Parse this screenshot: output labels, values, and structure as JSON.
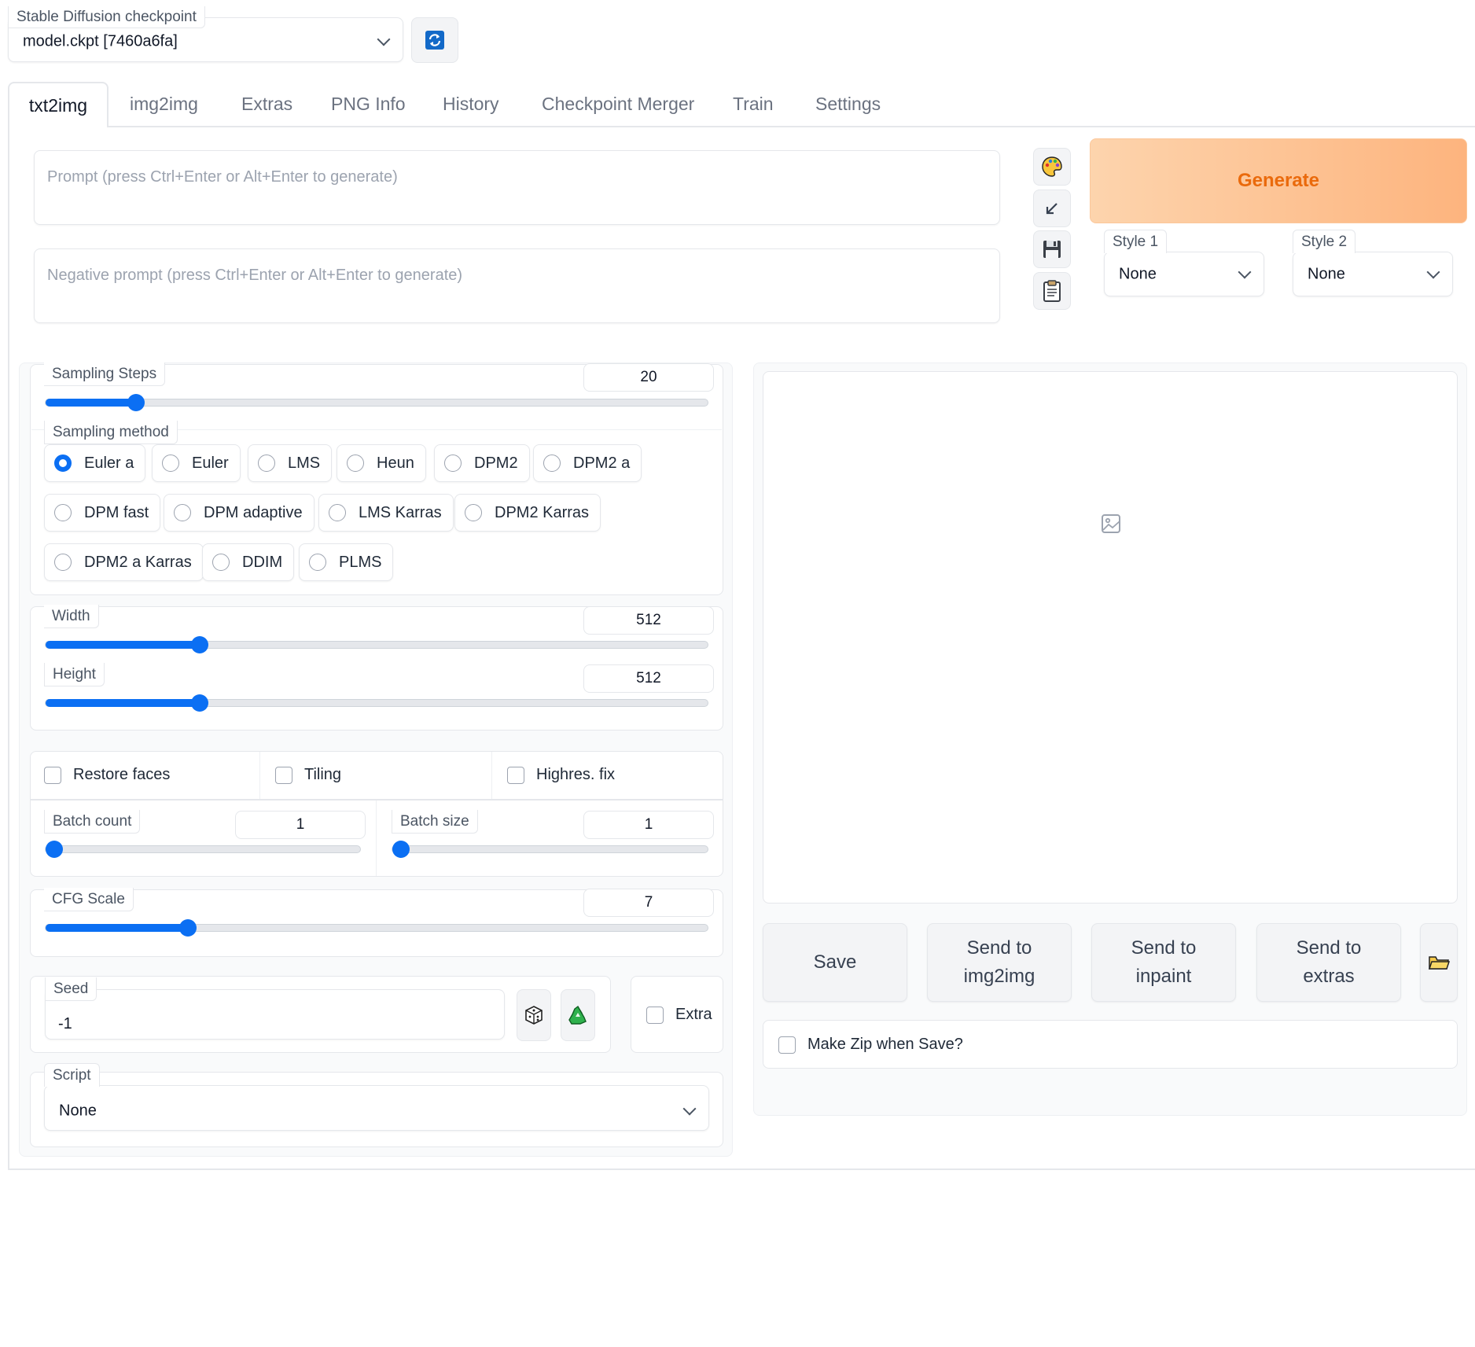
{
  "checkpoint": {
    "label": "Stable Diffusion checkpoint",
    "value": "model.ckpt [7460a6fa]"
  },
  "tabs": [
    {
      "label": "txt2img",
      "active": true
    },
    {
      "label": "img2img"
    },
    {
      "label": "Extras"
    },
    {
      "label": "PNG Info"
    },
    {
      "label": "History"
    },
    {
      "label": "Checkpoint Merger"
    },
    {
      "label": "Train"
    },
    {
      "label": "Settings"
    }
  ],
  "prompt": {
    "placeholder": "Prompt (press Ctrl+Enter or Alt+Enter to generate)"
  },
  "negative_prompt": {
    "placeholder": "Negative prompt (press Ctrl+Enter or Alt+Enter to generate)"
  },
  "tool_icons": [
    "palette-icon",
    "arrow-down-left-icon",
    "floppy-disk-icon",
    "clipboard-icon"
  ],
  "generate": {
    "label": "Generate"
  },
  "styles": {
    "style1_label": "Style 1",
    "style1_value": "None",
    "style2_label": "Style 2",
    "style2_value": "None"
  },
  "sampling_steps": {
    "label": "Sampling Steps",
    "value": "20",
    "min": 1,
    "max": 150
  },
  "sampling_method": {
    "label": "Sampling method",
    "options": [
      "Euler a",
      "Euler",
      "LMS",
      "Heun",
      "DPM2",
      "DPM2 a",
      "DPM fast",
      "DPM adaptive",
      "LMS Karras",
      "DPM2 Karras",
      "DPM2 a Karras",
      "DDIM",
      "PLMS"
    ],
    "selected": "Euler a"
  },
  "width": {
    "label": "Width",
    "value": "512",
    "min": 64,
    "max": 2048
  },
  "height": {
    "label": "Height",
    "value": "512",
    "min": 64,
    "max": 2048
  },
  "checkboxes": {
    "restore_faces": "Restore faces",
    "tiling": "Tiling",
    "highres_fix": "Highres. fix"
  },
  "batch_count": {
    "label": "Batch count",
    "value": "1",
    "min": 1,
    "max": 100
  },
  "batch_size": {
    "label": "Batch size",
    "value": "1",
    "min": 1,
    "max": 8
  },
  "cfg_scale": {
    "label": "CFG Scale",
    "value": "7",
    "min": 1,
    "max": 30
  },
  "seed": {
    "label": "Seed",
    "value": "-1",
    "extra_label": "Extra"
  },
  "script": {
    "label": "Script",
    "value": "None"
  },
  "output": {
    "save": "Save",
    "send_img2img": "Send to\nimg2img",
    "send_inpaint": "Send to\ninpaint",
    "send_extras": "Send to\nextras",
    "make_zip": "Make Zip when Save?"
  },
  "colors": {
    "accent": "#0b6ff3",
    "generate_text": "#ea6a0c",
    "generate_bg_from": "#fdd4ad",
    "generate_bg_to": "#fdb47e"
  }
}
